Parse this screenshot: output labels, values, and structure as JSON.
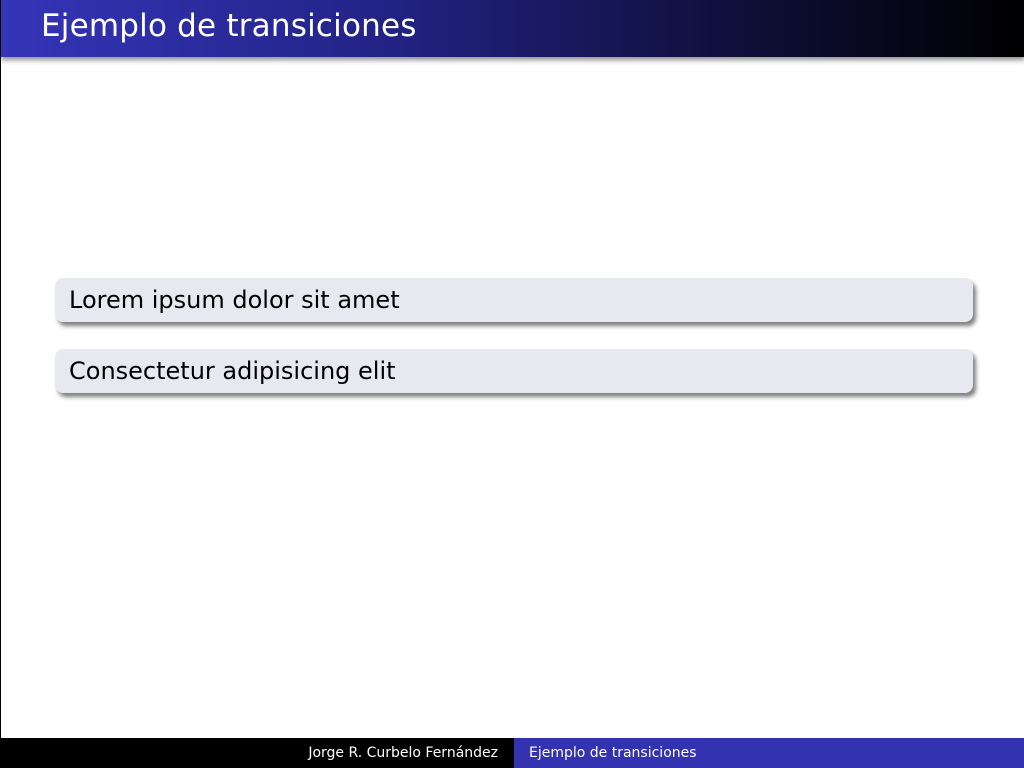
{
  "frame": {
    "title": "Ejemplo de transiciones"
  },
  "blocks": [
    {
      "text": "Lorem ipsum dolor sit amet"
    },
    {
      "text": "Consectetur adipisicing elit"
    }
  ],
  "footer": {
    "author": "Jorge R. Curbelo Fernández",
    "title": "Ejemplo de transiciones"
  },
  "colors": {
    "title_bar_start": "#3535b8",
    "title_bar_end": "#000000",
    "block_background": "#e8e8f1",
    "footer_author_bg": "#000000",
    "footer_title_bg": "#3333b2"
  }
}
